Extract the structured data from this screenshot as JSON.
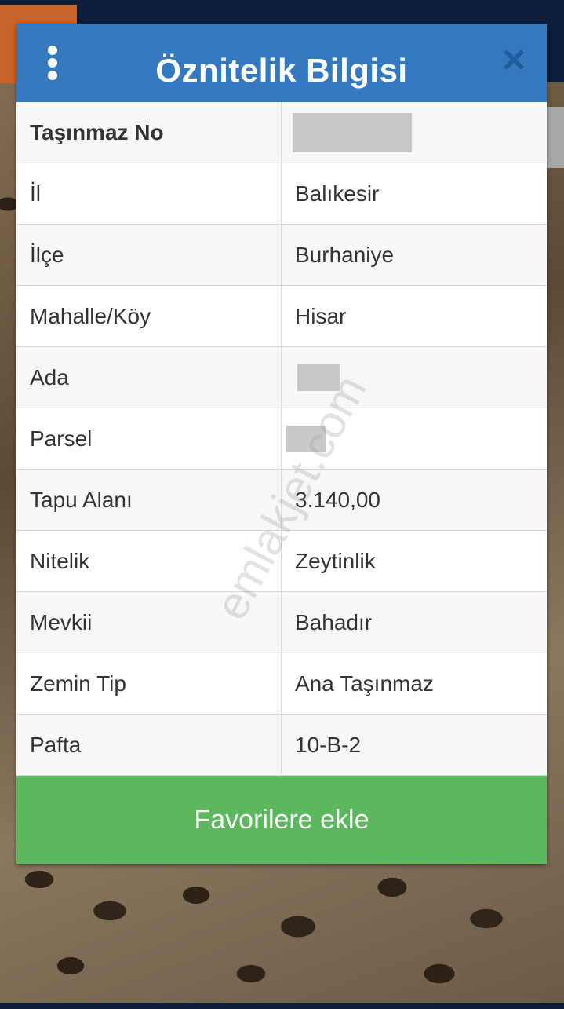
{
  "dialog": {
    "title": "Öznitelik Bilgisi",
    "menu_icon": "kebab-menu-icon",
    "close_icon": "close-icon"
  },
  "attributes": [
    {
      "key": "Taşınmaz No",
      "value": "",
      "redacted": true
    },
    {
      "key": "İl",
      "value": "Balıkesir"
    },
    {
      "key": "İlçe",
      "value": "Burhaniye"
    },
    {
      "key": "Mahalle/Köy",
      "value": "Hisar"
    },
    {
      "key": "Ada",
      "value": "",
      "redacted": true
    },
    {
      "key": "Parsel",
      "value": "",
      "redacted": true
    },
    {
      "key": "Tapu Alanı",
      "value": "3.140,00"
    },
    {
      "key": "Nitelik",
      "value": "Zeytinlik"
    },
    {
      "key": "Mevkii",
      "value": "Bahadır"
    },
    {
      "key": "Zemin Tip",
      "value": "Ana Taşınmaz"
    },
    {
      "key": "Pafta",
      "value": "10-B-2"
    }
  ],
  "actions": {
    "favorite_label": "Favorilere ekle"
  },
  "watermark": "emlakjet.com",
  "colors": {
    "header": "#3479bf",
    "favorite_button": "#5cb85c"
  }
}
